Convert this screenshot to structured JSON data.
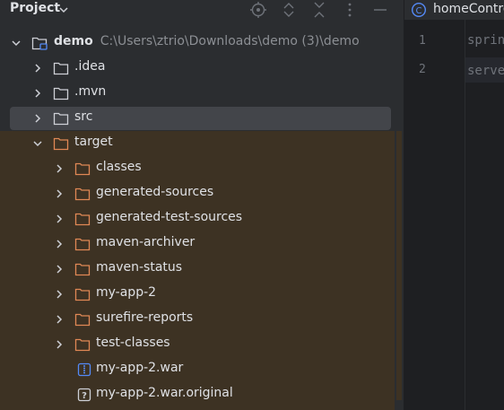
{
  "header": {
    "title": "Project",
    "icons": [
      "chevron-down-icon",
      "locate-icon",
      "expand-all-icon",
      "collapse-all-icon",
      "more-options-icon",
      "hide-icon"
    ]
  },
  "tree": {
    "root": {
      "name": "demo",
      "path": "C:\\Users\\ztrio\\Downloads\\demo (3)\\demo"
    },
    "items": [
      {
        "label": ".idea"
      },
      {
        "label": ".mvn"
      },
      {
        "label": "src"
      },
      {
        "label": "target"
      },
      {
        "label": "classes"
      },
      {
        "label": "generated-sources"
      },
      {
        "label": "generated-test-sources"
      },
      {
        "label": "maven-archiver"
      },
      {
        "label": "maven-status"
      },
      {
        "label": "my-app-2"
      },
      {
        "label": "surefire-reports"
      },
      {
        "label": "test-classes"
      },
      {
        "label": "my-app-2.war"
      },
      {
        "label": "my-app-2.war.original"
      }
    ]
  },
  "editor": {
    "tab_label": "homeControl",
    "line_numbers": [
      "1",
      "2"
    ],
    "lines": [
      "sprin",
      "serve"
    ]
  },
  "colors": {
    "background": "#2b2d30",
    "editor_bg": "#1e1f22",
    "excluded_folder_bg": "#3d3223",
    "selection": "#43454a",
    "folder_plain": "#ced0d6",
    "folder_excluded": "#e08855",
    "class_icon": "#548af7"
  }
}
